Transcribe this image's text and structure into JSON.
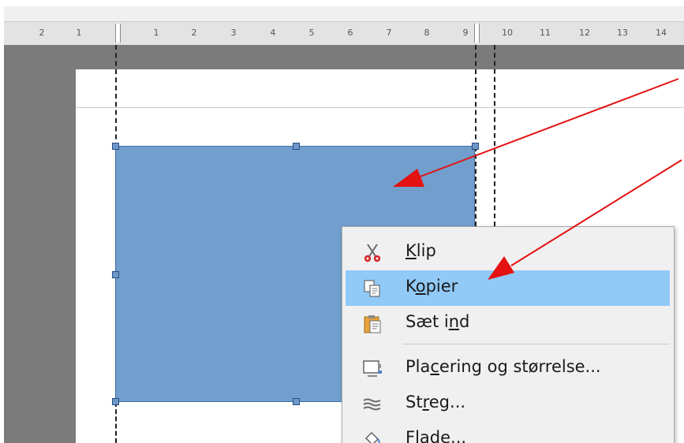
{
  "ruler": {
    "labels": [
      "2",
      "1",
      "1",
      "2",
      "3",
      "4",
      "5",
      "6",
      "7",
      "8",
      "9",
      "10",
      "11",
      "12",
      "13",
      "14"
    ]
  },
  "context_menu": {
    "items": [
      {
        "pre": "",
        "key": "K",
        "post": "lip",
        "icon": "scissors-icon"
      },
      {
        "pre": "K",
        "key": "o",
        "post": "pier",
        "icon": "copy-icon"
      },
      {
        "pre": "Sæt i",
        "key": "n",
        "post": "d",
        "icon": "paste-icon"
      },
      {
        "pre": "Pla",
        "key": "c",
        "post": "ering og størrelse...",
        "icon": "position-size-icon"
      },
      {
        "pre": "St",
        "key": "r",
        "post": "eg...",
        "icon": "line-style-icon"
      },
      {
        "pre": "",
        "key": "F",
        "post": "lade...",
        "icon": "fill-bucket-icon"
      }
    ],
    "highlighted_index": 1
  },
  "colors": {
    "shape_fill": "#719ecd",
    "shape_border": "#3f6ea3",
    "menu_highlight": "#91c9f7",
    "annotation_arrow": "#e41212",
    "workspace": "#7b7b7b"
  }
}
